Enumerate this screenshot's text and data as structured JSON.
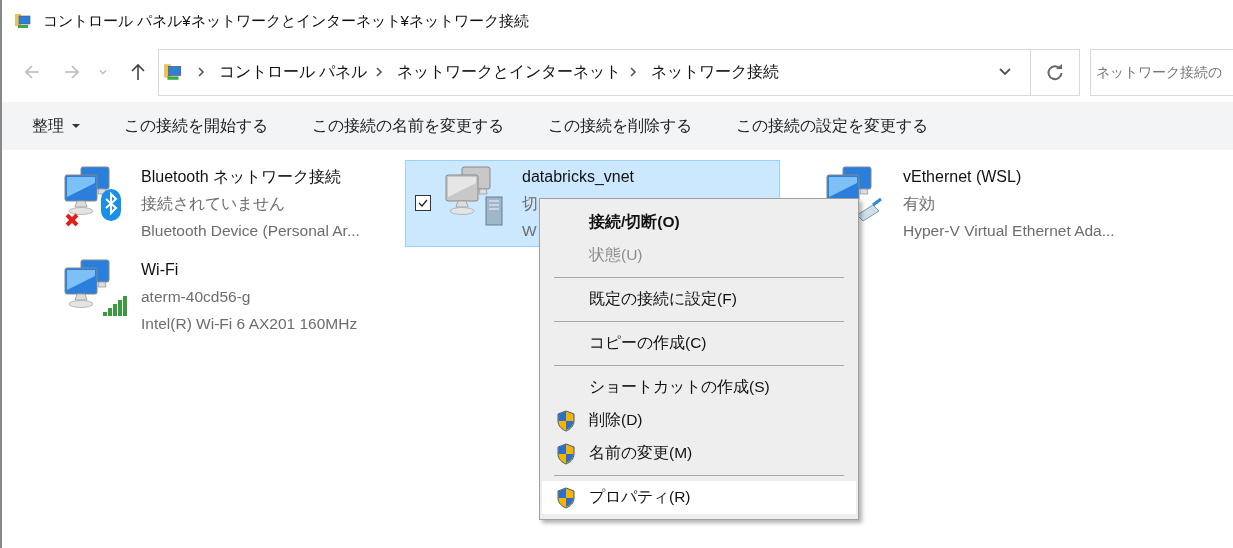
{
  "window": {
    "title": "コントロール パネル¥ネットワークとインターネット¥ネットワーク接続"
  },
  "address_bar": {
    "crumbs": [
      "コントロール パネル",
      "ネットワークとインターネット",
      "ネットワーク接続"
    ]
  },
  "search": {
    "placeholder": "ネットワーク接続の"
  },
  "command_bar": [
    {
      "label": "整理",
      "dropdown": true
    },
    {
      "label": "この接続を開始する",
      "dropdown": false
    },
    {
      "label": "この接続の名前を変更する",
      "dropdown": false
    },
    {
      "label": "この接続を削除する",
      "dropdown": false
    },
    {
      "label": "この接続の設定を変更する",
      "dropdown": false
    }
  ],
  "connections": [
    {
      "name": "Bluetooth ネットワーク接続",
      "status": "接続されていません",
      "device": "Bluetooth Device (Personal Ar...",
      "kind": "bluetooth",
      "disabled": false,
      "selected": false,
      "checked": false
    },
    {
      "name": "databricks_vnet",
      "status": "切",
      "device": "W",
      "kind": "vpn",
      "disabled": true,
      "selected": true,
      "checked": true
    },
    {
      "name": "vEthernet (WSL)",
      "status": "有効",
      "device": "Hyper-V Virtual Ethernet Ada...",
      "kind": "ethernet",
      "disabled": false,
      "selected": false,
      "checked": false
    },
    {
      "name": "Wi-Fi",
      "status": "aterm-40cd56-g",
      "device": "Intel(R) Wi-Fi 6 AX201 160MHz",
      "kind": "wifi",
      "disabled": false,
      "selected": false,
      "checked": false
    }
  ],
  "context_menu": [
    {
      "kind": "item",
      "label": "接続/切断(O)",
      "bold": true,
      "disabled": false,
      "shield": false,
      "selected": false
    },
    {
      "kind": "item",
      "label": "状態(U)",
      "bold": false,
      "disabled": true,
      "shield": false,
      "selected": false
    },
    {
      "kind": "separator"
    },
    {
      "kind": "item",
      "label": "既定の接続に設定(F)",
      "bold": false,
      "disabled": false,
      "shield": false,
      "selected": false
    },
    {
      "kind": "separator"
    },
    {
      "kind": "item",
      "label": "コピーの作成(C)",
      "bold": false,
      "disabled": false,
      "shield": false,
      "selected": false
    },
    {
      "kind": "separator"
    },
    {
      "kind": "item",
      "label": "ショートカットの作成(S)",
      "bold": false,
      "disabled": false,
      "shield": false,
      "selected": false
    },
    {
      "kind": "item",
      "label": "削除(D)",
      "bold": false,
      "disabled": false,
      "shield": true,
      "selected": false
    },
    {
      "kind": "item",
      "label": "名前の変更(M)",
      "bold": false,
      "disabled": false,
      "shield": true,
      "selected": false
    },
    {
      "kind": "separator"
    },
    {
      "kind": "item",
      "label": "プロパティ(R)",
      "bold": false,
      "disabled": false,
      "shield": true,
      "selected": true
    }
  ]
}
